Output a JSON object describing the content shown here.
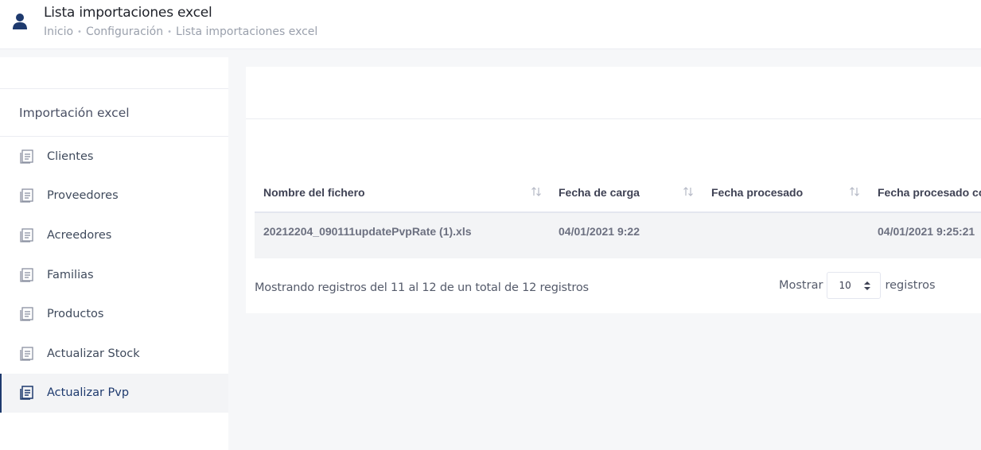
{
  "header": {
    "title": "Lista importaciones excel",
    "breadcrumb": [
      "Inicio",
      "Configuración",
      "Lista importaciones excel"
    ]
  },
  "sidebar": {
    "section_title": "Importación excel",
    "items": [
      {
        "label": "Clientes",
        "icon": "document-icon"
      },
      {
        "label": "Proveedores",
        "icon": "document-icon"
      },
      {
        "label": "Acreedores",
        "icon": "document-icon"
      },
      {
        "label": "Familias",
        "icon": "document-icon"
      },
      {
        "label": "Productos",
        "icon": "document-icon"
      },
      {
        "label": "Actualizar Stock",
        "icon": "document-icon"
      },
      {
        "label": "Actualizar Pvp",
        "icon": "document-icon",
        "active": true
      }
    ]
  },
  "table": {
    "columns": [
      "Nombre del fichero",
      "Fecha de carga",
      "Fecha procesado",
      "Fecha procesado co"
    ],
    "rows": [
      [
        "20212204_090111updatePvpRate (1).xls",
        "04/01/2021 9:22",
        "",
        "04/01/2021 9:25:21"
      ]
    ]
  },
  "pagination": {
    "info": "Mostrando registros del 11 al 12 de un total de 12 registros",
    "show_label": "Mostrar",
    "page_size": "10",
    "records_label": "registros"
  },
  "colors": {
    "accent": "#1e3a6e",
    "active_bg": "#f3f4f6",
    "border": "#ebedf2"
  }
}
